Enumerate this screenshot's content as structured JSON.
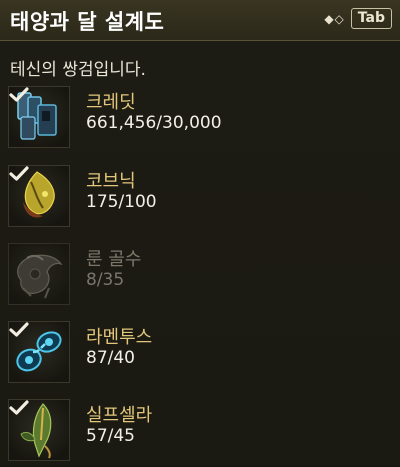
{
  "header": {
    "title": "태양과 달 설계도",
    "indicator": "◆◇",
    "hotkey": "Tab"
  },
  "description": "테신의 쌍검입니다.",
  "items": [
    {
      "name": "크레딧",
      "count": "661,456/30,000",
      "icon": "credits-icon",
      "complete": true
    },
    {
      "name": "코브닉",
      "count": "175/100",
      "icon": "kovnik-icon",
      "complete": true
    },
    {
      "name": "룬 골수",
      "count": "8/35",
      "icon": "rune-marrow-icon",
      "complete": false
    },
    {
      "name": "라멘투스",
      "count": "87/40",
      "icon": "lamentus-icon",
      "complete": true
    },
    {
      "name": "실프셀라",
      "count": "57/45",
      "icon": "sylphsela-icon",
      "complete": true
    }
  ],
  "colors": {
    "name": "#e2c67a",
    "count": "#f2efe6",
    "check": "#f2eee2",
    "accent": "#4cc6e8"
  }
}
